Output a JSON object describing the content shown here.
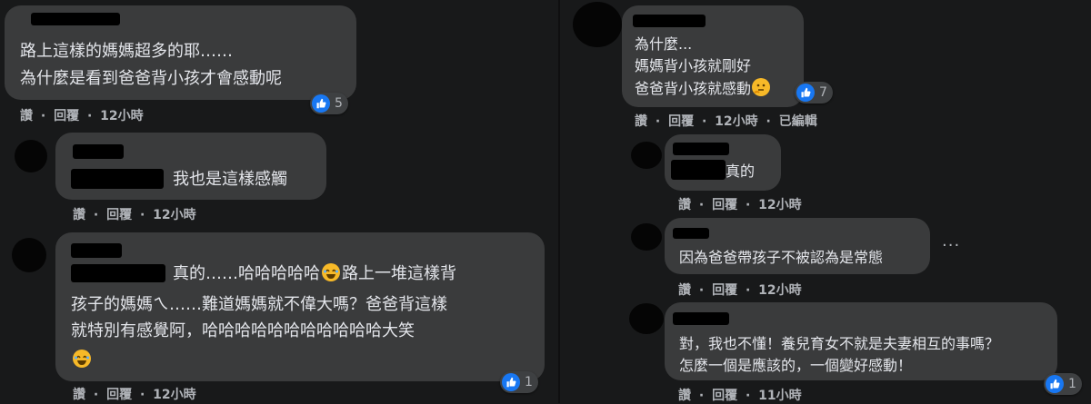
{
  "left": {
    "c1": {
      "line1": "路上這樣的媽媽超多的耶……",
      "line2": "為什麼是看到爸爸背小孩才會感動呢",
      "reactions": "5",
      "actions": [
        "讚",
        "·",
        "回覆",
        "·",
        "12小時"
      ]
    },
    "c2": {
      "text": "我也是這樣感觸",
      "actions": [
        "讚",
        "·",
        "回覆",
        "·",
        "12小時"
      ]
    },
    "c3": {
      "line1": "真的……哈哈哈哈哈",
      "line1b": "路上一堆這樣背",
      "line2": "孩子的媽媽ㄟ……難道媽媽就不偉大嗎？爸爸背這樣",
      "line3": "就特別有感覺阿，哈哈哈哈哈哈哈哈哈哈哈大笑",
      "reactions": "1",
      "actions": [
        "讚",
        "·",
        "回覆",
        "·",
        "12小時"
      ]
    }
  },
  "right": {
    "c1": {
      "line1": "為什麼...",
      "line2": "媽媽背小孩就剛好",
      "line3": "爸爸背小孩就感動",
      "reactions": "7",
      "actions": [
        "讚",
        "·",
        "回覆",
        "·",
        "12小時",
        "·",
        "已編輯"
      ]
    },
    "c2": {
      "text": "真的",
      "actions": [
        "讚",
        "·",
        "回覆",
        "·",
        "12小時"
      ]
    },
    "c3": {
      "text": "因為爸爸帶孩子不被認為是常態",
      "actions": [
        "讚",
        "·",
        "回覆",
        "·",
        "12小時"
      ],
      "more": "···"
    },
    "c4": {
      "line1": "對，我也不懂！養兒育女不就是夫妻相互的事嗎？",
      "line2": "怎麼一個是應該的，一個變好感動！",
      "reactions": "1",
      "actions": [
        "讚",
        "·",
        "回覆",
        "·",
        "11小時"
      ]
    }
  },
  "icons": {
    "like": "like-thumb-icon",
    "laugh": "laughing-emoji-icon",
    "thinking": "thinking-emoji-icon",
    "more": "more-dots-icon"
  },
  "colors": {
    "background": "#18191a",
    "bubble": "#3a3b3c",
    "like": "#1877f2",
    "meta": "#b0b3b8",
    "text": "#e4e6eb"
  }
}
